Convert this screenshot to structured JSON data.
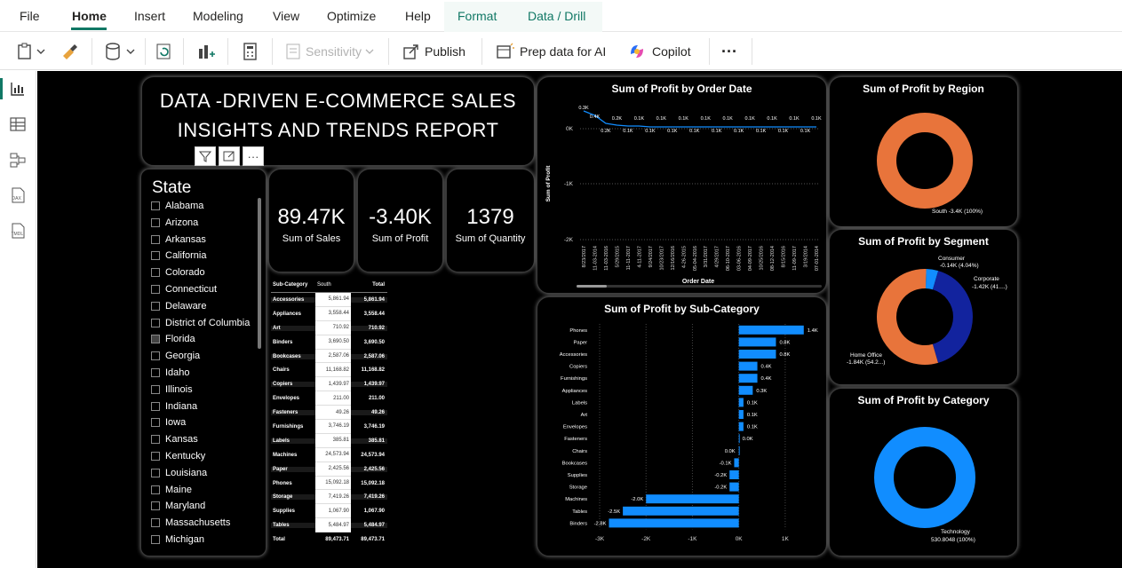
{
  "menu": {
    "file": "File",
    "home": "Home",
    "insert": "Insert",
    "modeling": "Modeling",
    "view": "View",
    "optimize": "Optimize",
    "help": "Help",
    "format": "Format",
    "data_drill": "Data / Drill"
  },
  "toolbar": {
    "sensitivity": "Sensitivity",
    "publish": "Publish",
    "prep_data": "Prep data for AI",
    "copilot": "Copilot",
    "more": "···"
  },
  "report_title": {
    "line1": "DATA -DRIVEN  E-COMMERCE  SALES",
    "line2": "INSIGHTS AND TRENDS REPORT"
  },
  "kpis": [
    {
      "value": "89.47K",
      "label": "Sum of Sales"
    },
    {
      "value": "-3.40K",
      "label": "Sum of Profit"
    },
    {
      "value": "1379",
      "label": "Sum of Quantity"
    }
  ],
  "slicer": {
    "title": "State",
    "items": [
      "Alabama",
      "Arizona",
      "Arkansas",
      "California",
      "Colorado",
      "Connecticut",
      "Delaware",
      "District of Columbia",
      "Florida",
      "Georgia",
      "Idaho",
      "Illinois",
      "Indiana",
      "Iowa",
      "Kansas",
      "Kentucky",
      "Louisiana",
      "Maine",
      "Maryland",
      "Massachusetts",
      "Michigan"
    ]
  },
  "matrix": {
    "headers": [
      "Sub-Category",
      "South",
      "Total"
    ],
    "rows": [
      [
        "Accessories",
        "5,861.94",
        "5,861.94"
      ],
      [
        "Appliances",
        "3,558.44",
        "3,558.44"
      ],
      [
        "Art",
        "710.92",
        "710.92"
      ],
      [
        "Binders",
        "3,690.50",
        "3,690.50"
      ],
      [
        "Bookcases",
        "2,587.06",
        "2,587.06"
      ],
      [
        "Chairs",
        "11,168.82",
        "11,168.82"
      ],
      [
        "Copiers",
        "1,439.97",
        "1,439.97"
      ],
      [
        "Envelopes",
        "211.00",
        "211.00"
      ],
      [
        "Fasteners",
        "49.26",
        "49.26"
      ],
      [
        "Furnishings",
        "3,746.19",
        "3,746.19"
      ],
      [
        "Labels",
        "385.81",
        "385.81"
      ],
      [
        "Machines",
        "24,573.94",
        "24,573.94"
      ],
      [
        "Paper",
        "2,425.56",
        "2,425.56"
      ],
      [
        "Phones",
        "15,092.18",
        "15,092.18"
      ],
      [
        "Storage",
        "7,419.26",
        "7,419.26"
      ],
      [
        "Supplies",
        "1,067.90",
        "1,067.90"
      ],
      [
        "Tables",
        "5,484.97",
        "5,484.97"
      ]
    ],
    "total": [
      "Total",
      "89,473.71",
      "89,473.71"
    ]
  },
  "line_chart": {
    "title": "Sum of Profit by Order Date",
    "ylabel": "Sum of Profit",
    "xlabel": "Order Date",
    "yticks": [
      "0K",
      "-1K",
      "-2K"
    ],
    "dates": [
      "8/23/2017",
      "11-03-2014",
      "11-03-2016",
      "5/29/2015",
      "11-11-2017",
      "4-11-2017",
      "9/24/2017",
      "10/23/2017",
      "12/16/2016",
      "4-26-2015",
      "05-04-2016",
      "3/31/2017",
      "4/29/2017",
      "06-10-2017",
      "03-06-2016",
      "04-09-2017",
      "10/25/2016",
      "08-12-2014",
      "8/15/2016",
      "11-09-2017",
      "3/19/2014",
      "07-01-2014"
    ],
    "labels": [
      "0.3K",
      "0.4K",
      "0.2K",
      "0.2K",
      "0.1K",
      "0.1K",
      "0.1K",
      "0.1K",
      "0.1K",
      "0.1K",
      "0.1K",
      "0.1K",
      "0.1K",
      "0.1K",
      "0.1K",
      "0.1K",
      "0.1K",
      "0.1K",
      "0.1K",
      "0.1K",
      "0.1K",
      "0.1K"
    ]
  },
  "region_chart": {
    "title": "Sum of Profit by Region",
    "label": "South -3.4K (100%)",
    "color": "#E8743B"
  },
  "segment_chart": {
    "title": "Sum of Profit by Segment",
    "labels": [
      "Consumer",
      "-0.14K (4.04%)",
      "Corporate",
      "-1.42K (41....)",
      "Home Office",
      "-1.84K (54.2...)"
    ]
  },
  "category_chart": {
    "title": "Sum of Profit by Category",
    "label1": "Technology",
    "label2": "530.8048 (100%)",
    "color": "#118DFF"
  },
  "chart_data": {
    "type": "bar",
    "title": "Sum of Profit by Sub-Category",
    "categories": [
      "Phones",
      "Paper",
      "Accessories",
      "Copiers",
      "Furnishings",
      "Appliances",
      "Labels",
      "Art",
      "Envelopes",
      "Fasteners",
      "Chairs",
      "Bookcases",
      "Supplies",
      "Storage",
      "Machines",
      "Tables",
      "Binders"
    ],
    "values": [
      1.4,
      0.8,
      0.8,
      0.4,
      0.4,
      0.3,
      0.1,
      0.1,
      0.1,
      0.0,
      0.0,
      -0.1,
      -0.2,
      -0.2,
      -2.0,
      -2.5,
      -2.8
    ],
    "value_labels": [
      "1.4K",
      "0.8K",
      "0.8K",
      "0.4K",
      "0.4K",
      "0.3K",
      "0.1K",
      "0.1K",
      "0.1K",
      "0.0K",
      "0.0K",
      "-0.1K",
      "-0.2K",
      "-0.2K",
      "-2.0K",
      "-2.5K",
      "-2.8K"
    ],
    "xticks": [
      "-3K",
      "-2K",
      "-1K",
      "0K",
      "1K"
    ],
    "xlim": [
      -3,
      1.5
    ],
    "color": "#118DFF"
  }
}
